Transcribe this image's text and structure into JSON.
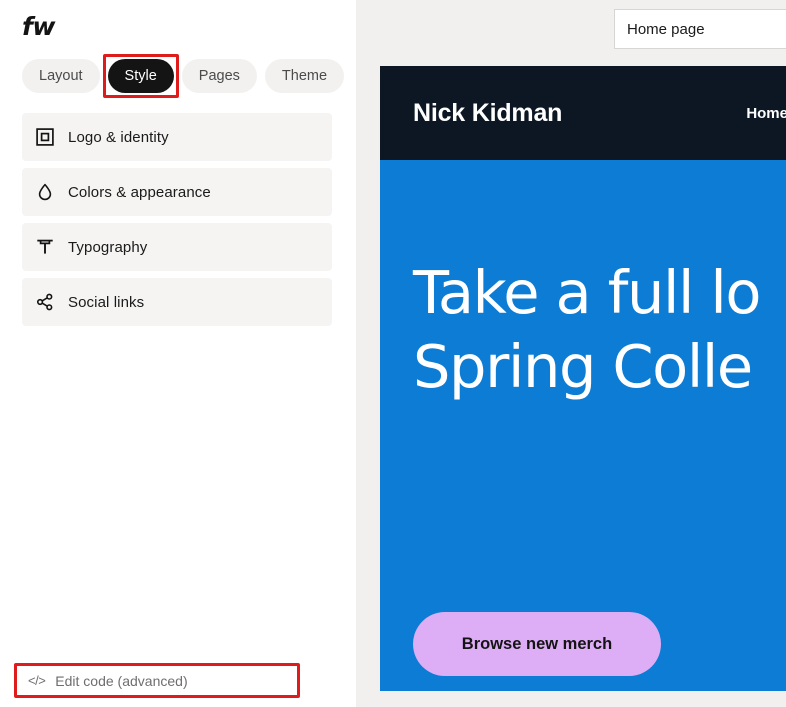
{
  "sidebar": {
    "brand": "fw",
    "tabs": [
      {
        "label": "Layout",
        "active": false,
        "highlighted": false
      },
      {
        "label": "Style",
        "active": true,
        "highlighted": true
      },
      {
        "label": "Pages",
        "active": false,
        "highlighted": false
      },
      {
        "label": "Theme",
        "active": false,
        "highlighted": false
      }
    ],
    "menu_items": [
      {
        "label": "Logo & identity",
        "icon": "square-outline-icon"
      },
      {
        "label": "Colors & appearance",
        "icon": "droplet-icon"
      },
      {
        "label": "Typography",
        "icon": "text-type-icon"
      },
      {
        "label": "Social links",
        "icon": "share-nodes-icon"
      }
    ],
    "edit_code": {
      "label": "Edit code (advanced)",
      "icon": "code-brackets-icon",
      "icon_text": "</>"
    }
  },
  "preview": {
    "page_selector": {
      "value": "Home page"
    },
    "site": {
      "title": "Nick Kidman",
      "nav_links": [
        "Home"
      ],
      "hero": {
        "heading_line_1": "Take a full lo",
        "heading_line_2": "Spring Colle",
        "button_label": "Browse new merch"
      }
    }
  },
  "colors": {
    "active_tab_bg": "#141414",
    "tab_bg": "#f2f1f0",
    "menu_row_bg": "#f5f4f3",
    "highlight_red": "#e01b1b",
    "site_nav_bg": "#0d1724",
    "hero_bg": "#0c7cd5",
    "hero_button_bg": "#ddaef5",
    "canvas_surround": "#f1f0ef"
  }
}
